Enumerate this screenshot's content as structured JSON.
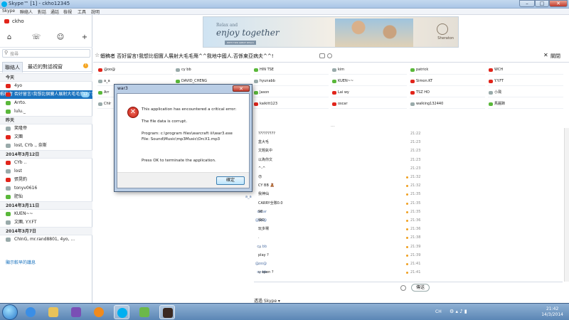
{
  "window": {
    "title": "Skype™ [1] - ckho12345",
    "min": "–",
    "max": "□",
    "close": "✕"
  },
  "menu": [
    "Skype",
    "聯絡人",
    "對話",
    "通話",
    "檢視",
    "工具",
    "說明"
  ],
  "profile": {
    "name": "ckho"
  },
  "search": {
    "placeholder": "搜尋"
  },
  "tabs": {
    "contacts": "聯絡人",
    "recent": "最近的對話視窗"
  },
  "recent": [
    {
      "kind": "hdr",
      "text": "今天"
    },
    {
      "kind": "item",
      "text": "4yo",
      "icon": "red"
    },
    {
      "kind": "sel",
      "text": "蝦稿者 否好留言!我想比個竇人展射大毛毛殤^^我地中國人.否係東亞病夫^^!",
      "icon": "red",
      "badge": "12"
    },
    {
      "kind": "item",
      "text": "Arrto.",
      "icon": "grn"
    },
    {
      "kind": "item",
      "text": "lulu._",
      "icon": "grn"
    },
    {
      "kind": "hdr",
      "text": "昨天"
    },
    {
      "kind": "item",
      "text": "笑隆帝",
      "icon": "gry"
    },
    {
      "kind": "item",
      "text": "文團",
      "icon": "red"
    },
    {
      "kind": "item",
      "text": "lost, CYb ., 奈斯",
      "icon": "gry"
    },
    {
      "kind": "hdr",
      "text": "2014年3月12日"
    },
    {
      "kind": "item",
      "text": "CYb ..",
      "icon": "red"
    },
    {
      "kind": "item",
      "text": "lost",
      "icon": "gry"
    },
    {
      "kind": "item",
      "text": "張晃釣",
      "icon": "red"
    },
    {
      "kind": "item",
      "text": "tonyv0616",
      "icon": "gry"
    },
    {
      "kind": "item",
      "text": "肥仙",
      "icon": "grn"
    },
    {
      "kind": "hdr",
      "text": "2014年3月11日"
    },
    {
      "kind": "item",
      "text": "KUEN~~",
      "icon": "grn"
    },
    {
      "kind": "item",
      "text": "文團, Y.Y.FT",
      "icon": "gry"
    },
    {
      "kind": "hdr",
      "text": "2014年3月7日"
    },
    {
      "kind": "item",
      "text": "ChInG, mr.rand8801, 4yo, ...",
      "icon": "gry"
    }
  ],
  "show_more": "顯示較早的議息",
  "ad": {
    "small": "Relax and",
    "big": "enjoy together",
    "sub": "WITH TWO GREAT DEALS",
    "brand": "Sheraton"
  },
  "conversation": {
    "title": "蝦稿者 否好留言!我想比個竇人展射大毛毛殤^^我地中國人.否係東亞病夫^^!",
    "hangup": "關閉"
  },
  "participants": [
    [
      "@oo@",
      "cy bb",
      "HIN TSE",
      "kim",
      "patrick",
      "WCH"
    ],
    [
      "a_a",
      "DAVID_CHENG",
      "hyunabb",
      "KUEN~~",
      "Simon.KT",
      "Y.Y.FT"
    ],
    [
      "Arr",
      "",
      "Jason",
      "Lai wy",
      "TSZ HO",
      "小飛"
    ],
    [
      "ChIr",
      "",
      "kaikitt123",
      "oscar",
      "walking132440",
      "馬麗蹄"
    ]
  ],
  "more_dots": "...",
  "messages": [
    {
      "sender": "",
      "text": "?????????",
      "time": "21:22",
      "dot": false
    },
    {
      "sender": "",
      "text": "盒大毛",
      "time": "21:23",
      "dot": false
    },
    {
      "sender": "",
      "text": "文題氣中",
      "time": "21:23",
      "dot": false
    },
    {
      "sender": "",
      "text": "以為你文",
      "time": "21:23",
      "dot": false
    },
    {
      "sender": "",
      "text": "^-^",
      "time": "21:23",
      "dot": false
    },
    {
      "sender": "",
      "text": "😠",
      "time": "21:32",
      "dot": true
    },
    {
      "sender": "",
      "text": "CY BB 🧸",
      "time": "21:32",
      "dot": true
    },
    {
      "sender": "",
      "text": "我神仙",
      "time": "21:35",
      "dot": true
    },
    {
      "sender": "",
      "text": "CARRY全隊0.0",
      "time": "21:35",
      "dot": true
    },
    {
      "sender": "oscar",
      "text": "98",
      "time": "21:35",
      "dot": true
    },
    {
      "sender": "@oo@",
      "text": "快D",
      "time": "21:36",
      "dot": true
    },
    {
      "sender": "",
      "text": "玩多場",
      "time": "21:36",
      "dot": true
    },
    {
      "sender": "",
      "text": ".",
      "time": "21:38",
      "dot": true
    },
    {
      "sender": "cy bb",
      "text": "...",
      "time": "21:39",
      "dot": true
    },
    {
      "sender": "",
      "text": "play ?",
      "time": "21:39",
      "dot": true
    },
    {
      "sender": "@oo@",
      "text": ".",
      "time": "21:41",
      "dot": true
    },
    {
      "sender": "cy bb",
      "text": "u open ?",
      "time": "21:41",
      "dot": true
    }
  ],
  "a_a_label": "a_a",
  "input": {
    "send": "傳送",
    "footer": "透過 Skype ▾"
  },
  "dialog": {
    "title": "war3",
    "close": "✕",
    "line1": "This application has encountered a critical error:",
    "line2": "The file data is corrupt.",
    "line3": "Program:   c:\\program files\\warcraft iii\\war3.exe",
    "line4": "File:           Sound\\Music\\mp3Music\\OrcX1.mp3",
    "line5": "Press OK to terminate the application.",
    "ok": "確定"
  },
  "taskbar": {
    "lang": "CH",
    "time": "21:42",
    "date": "14/3/2014"
  },
  "colors": {
    "accent": "#1a73bf",
    "skype": "#00aff0",
    "error": "#c41e12"
  }
}
